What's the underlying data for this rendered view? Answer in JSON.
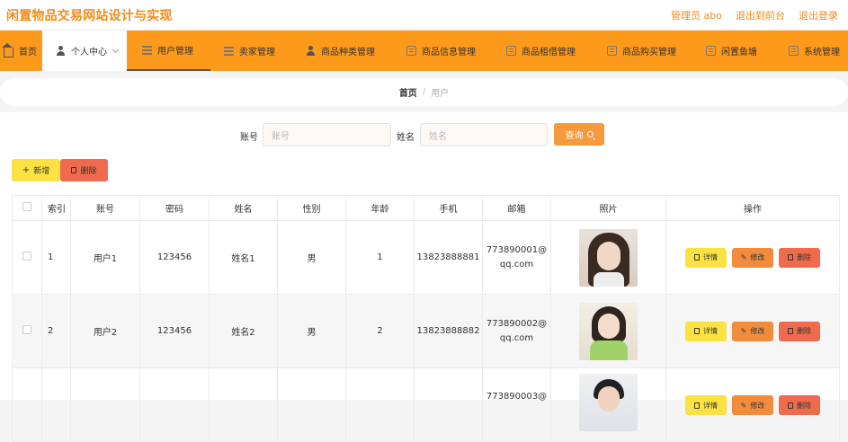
{
  "header": {
    "title": "闲置物品交易网站设计与实现",
    "links": [
      "管理员 abo",
      "退出到前台",
      "退出登录"
    ]
  },
  "nav": [
    {
      "label": "首页",
      "icon": "home-icon"
    },
    {
      "label": "个人中心",
      "icon": "user-icon"
    },
    {
      "label": "用户管理",
      "icon": "list-icon"
    },
    {
      "label": "卖家管理",
      "icon": "list-icon"
    },
    {
      "label": "商品种类管理",
      "icon": "user-icon"
    },
    {
      "label": "商品信息管理",
      "icon": "box-icon"
    },
    {
      "label": "商品租借管理",
      "icon": "box-icon"
    },
    {
      "label": "商品购买管理",
      "icon": "box-icon"
    },
    {
      "label": "闲置鱼塘",
      "icon": "box-icon"
    },
    {
      "label": "系统管理",
      "icon": "box-icon"
    }
  ],
  "breadcrumb": {
    "home": "首页",
    "separator": "/",
    "current": "用户"
  },
  "search": {
    "account_label": "账号",
    "account_placeholder": "账号",
    "name_label": "姓名",
    "name_placeholder": "姓名",
    "query_label": "查询"
  },
  "toolbar": {
    "add_label": "新增",
    "delete_label": "删除"
  },
  "table": {
    "headers": [
      "",
      "索引",
      "账号",
      "密码",
      "姓名",
      "性别",
      "年龄",
      "手机",
      "邮箱",
      "照片",
      "操作"
    ],
    "rows": [
      {
        "index": "1",
        "account": "用户1",
        "password": "123456",
        "name": "姓名1",
        "gender": "男",
        "age": "1",
        "phone": "13823888881",
        "email1": "773890001@",
        "email2": "qq.com"
      },
      {
        "index": "2",
        "account": "用户2",
        "password": "123456",
        "name": "姓名2",
        "gender": "男",
        "age": "2",
        "phone": "13823888882",
        "email1": "773890002@",
        "email2": "qq.com"
      },
      {
        "index": "",
        "account": "",
        "password": "",
        "name": "",
        "gender": "",
        "age": "",
        "phone": "",
        "email1": "773890003@",
        "email2": ""
      }
    ],
    "actions": {
      "detail": "详情",
      "edit": "修改",
      "delete": "删除"
    }
  },
  "colors": {
    "accent": "#fe9a1b",
    "title": "#f08c1a",
    "yellow": "#fbe142",
    "orange": "#f08c3c",
    "red": "#f06a4d"
  }
}
